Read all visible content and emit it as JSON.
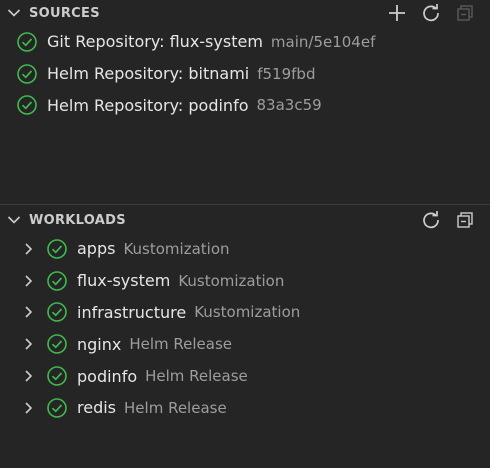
{
  "sources": {
    "title": "SOURCES",
    "items": [
      {
        "label": "Git Repository: flux-system",
        "description": "main/5e104ef"
      },
      {
        "label": "Helm Repository: bitnami",
        "description": "f519fbd"
      },
      {
        "label": "Helm Repository: podinfo",
        "description": "83a3c59"
      }
    ]
  },
  "workloads": {
    "title": "WORKLOADS",
    "items": [
      {
        "label": "apps",
        "description": "Kustomization"
      },
      {
        "label": "flux-system",
        "description": "Kustomization"
      },
      {
        "label": "infrastructure",
        "description": "Kustomization"
      },
      {
        "label": "nginx",
        "description": "Helm Release"
      },
      {
        "label": "podinfo",
        "description": "Helm Release"
      },
      {
        "label": "redis",
        "description": "Helm Release"
      }
    ]
  },
  "icons": {
    "status": "check-circle-icon",
    "add": "plus-icon",
    "refresh": "refresh-icon",
    "collapse": "collapse-all-icon",
    "expand": "chevron-right-icon",
    "section": "chevron-down-icon"
  },
  "colors": {
    "background": "#252526",
    "success": "#3fb950",
    "foreground": "#e6e6e6",
    "description": "#9d9d9d"
  }
}
